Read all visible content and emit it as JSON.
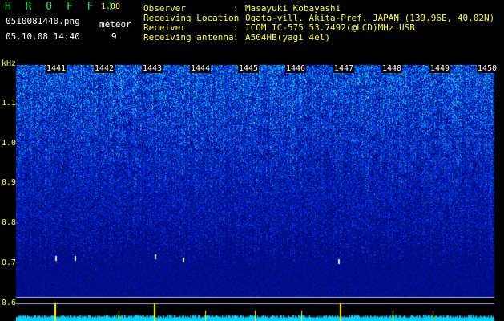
{
  "app": {
    "logo": "H R O F F T",
    "version": "1.00",
    "filename": "0510081440.png",
    "datetime": "05.10.08 14:40",
    "meteor_label": "meteor",
    "meteor_count": "9"
  },
  "info": [
    {
      "label": "Observer",
      "value": "Masayuki Kobayashi"
    },
    {
      "label": "Receiving Location",
      "value": "Ogata-vill. Akita-Pref. JAPAN (139.96E, 40.02N)"
    },
    {
      "label": "Receiver",
      "value": "ICOM IC-575 53.7492(@LCD)MHz USB"
    },
    {
      "label": "Receiving antenna",
      "value": "A504HB(yagi 4el)"
    }
  ],
  "spectrogram": {
    "unit": "kHz",
    "y_ticks": [
      "1.1",
      "1.0",
      "0.9",
      "0.8",
      "0.7",
      "0.6"
    ],
    "time_ticks": [
      "1441",
      "1442",
      "1443",
      "1444",
      "1445",
      "1446",
      "1447",
      "1448",
      "1449",
      "1450"
    ],
    "colors": {
      "bg_dark": "#000088",
      "bg_light": "#0050ff",
      "speckle": "#00e5ff",
      "bottom_bar": "#00d0ff",
      "marker": "#ffff00",
      "text": "#ffff33"
    }
  }
}
